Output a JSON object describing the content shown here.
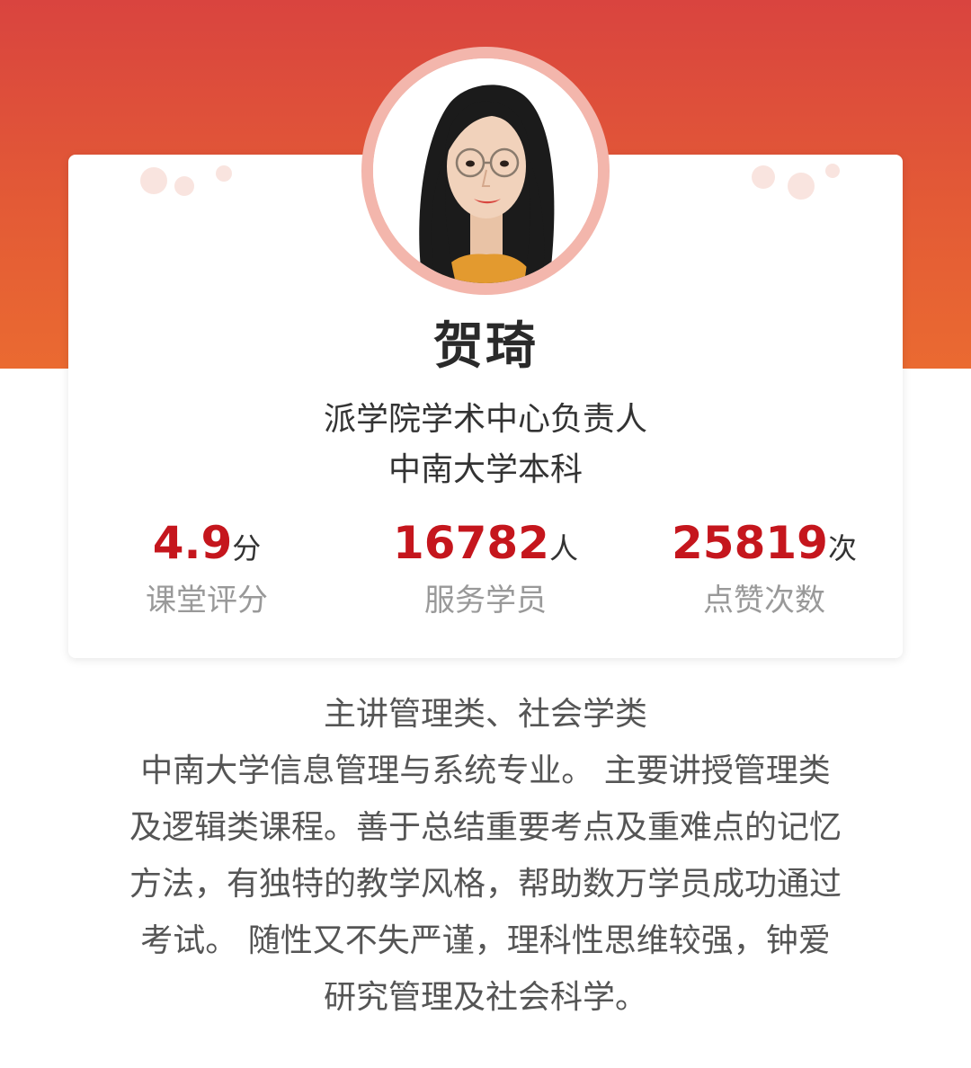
{
  "profile": {
    "name": "贺琦",
    "title_lines": [
      "派学院学术中心负责人",
      "中南大学本科"
    ]
  },
  "stats": [
    {
      "value": "4.9",
      "unit": "分",
      "label": "课堂评分"
    },
    {
      "value": "16782",
      "unit": "人",
      "label": "服务学员"
    },
    {
      "value": "25819",
      "unit": "次",
      "label": "点赞次数"
    }
  ],
  "bio": {
    "lines": [
      "主讲管理类、社会学类",
      "中南大学信息管理与系统专业。 主要讲授管理类",
      "及逻辑类课程。善于总结重要考点及重难点的记忆",
      "方法，有独特的教学风格，帮助数万学员成功通过",
      "考试。 随性又不失严谨，理科性思维较强，钟爱",
      "研究管理及社会科学。"
    ]
  },
  "colors": {
    "header_gradient_top": "#d9443f",
    "header_gradient_bottom": "#ea6a31",
    "stat_number": "#c5161d",
    "avatar_ring": "#f3b6ac"
  },
  "icons": {
    "avatar": "teacher-portrait"
  }
}
